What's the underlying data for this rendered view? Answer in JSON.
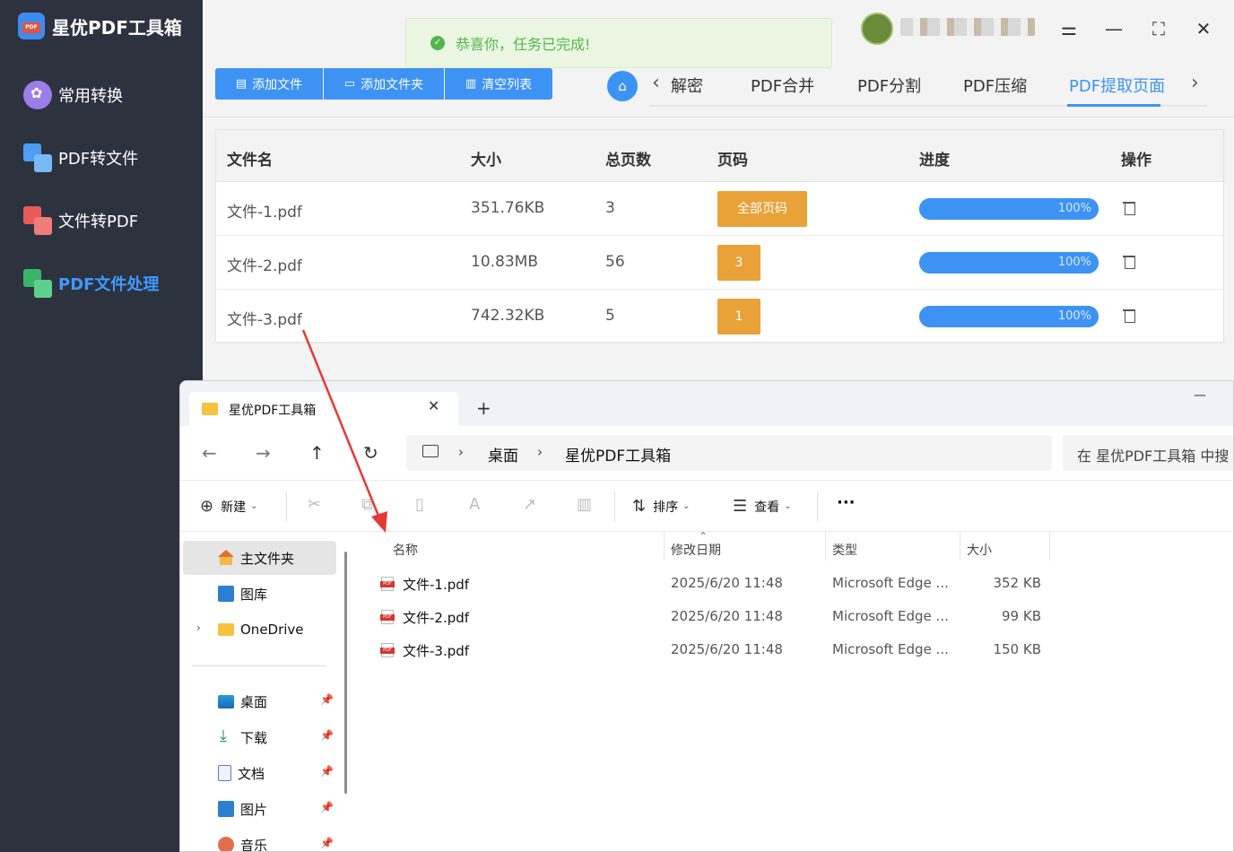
{
  "app": {
    "brand": "星优PDF工具箱",
    "sidebar": [
      {
        "label": "常用转换",
        "icon": "common-convert-icon",
        "active": false
      },
      {
        "label": "PDF转文件",
        "icon": "pdf-to-file-icon",
        "active": false
      },
      {
        "label": "文件转PDF",
        "icon": "file-to-pdf-icon",
        "active": false
      },
      {
        "label": "PDF文件处理",
        "icon": "pdf-process-icon",
        "active": true
      }
    ],
    "toast": "恭喜你，任务已完成!",
    "toolbar": {
      "add_file": "添加文件",
      "add_folder": "添加文件夹",
      "clear": "清空列表"
    },
    "tabs": [
      {
        "label": "解密",
        "active": false
      },
      {
        "label": "PDF合并",
        "active": false
      },
      {
        "label": "PDF分割",
        "active": false
      },
      {
        "label": "PDF压缩",
        "active": false
      },
      {
        "label": "PDF提取页面",
        "active": true
      }
    ],
    "table": {
      "headers": {
        "name": "文件名",
        "size": "大小",
        "pages": "总页数",
        "page_no": "页码",
        "progress": "进度",
        "action": "操作"
      },
      "rows": [
        {
          "name": "文件-1.pdf",
          "size": "351.76KB",
          "pages": "3",
          "page_no": "全部页码",
          "progress": "100%",
          "progress_value": 1.0
        },
        {
          "name": "文件-2.pdf",
          "size": "10.83MB",
          "pages": "56",
          "page_no": "3",
          "progress": "100%",
          "progress_value": 1.0
        },
        {
          "name": "文件-3.pdf",
          "size": "742.32KB",
          "pages": "5",
          "page_no": "1",
          "progress": "100%",
          "progress_value": 1.0
        }
      ]
    },
    "colors": {
      "accent": "#3d93f3",
      "sidebar_bg": "#2d323f",
      "page_btn": "#e8a237",
      "toast_text": "#54b64a"
    }
  },
  "explorer": {
    "tab_title": "星优PDF工具箱",
    "address": {
      "seg1": "桌面",
      "seg2": "星优PDF工具箱"
    },
    "search_placeholder": "在 星优PDF工具箱 中搜",
    "commands": {
      "new": "新建",
      "sort": "排序",
      "view": "查看",
      "more": "···"
    },
    "navpane": {
      "home": "主文件夹",
      "gallery": "图库",
      "onedrive": "OneDrive",
      "desktop": "桌面",
      "downloads": "下载",
      "documents": "文档",
      "pictures": "图片",
      "music": "音乐"
    },
    "columns": {
      "name": "名称",
      "date": "修改日期",
      "type": "类型",
      "size": "大小"
    },
    "files": [
      {
        "name": "文件-1.pdf",
        "date": "2025/6/20 11:48",
        "type": "Microsoft Edge ...",
        "size": "352 KB"
      },
      {
        "name": "文件-2.pdf",
        "date": "2025/6/20 11:48",
        "type": "Microsoft Edge ...",
        "size": "99 KB"
      },
      {
        "name": "文件-3.pdf",
        "date": "2025/6/20 11:48",
        "type": "Microsoft Edge ...",
        "size": "150 KB"
      }
    ]
  }
}
